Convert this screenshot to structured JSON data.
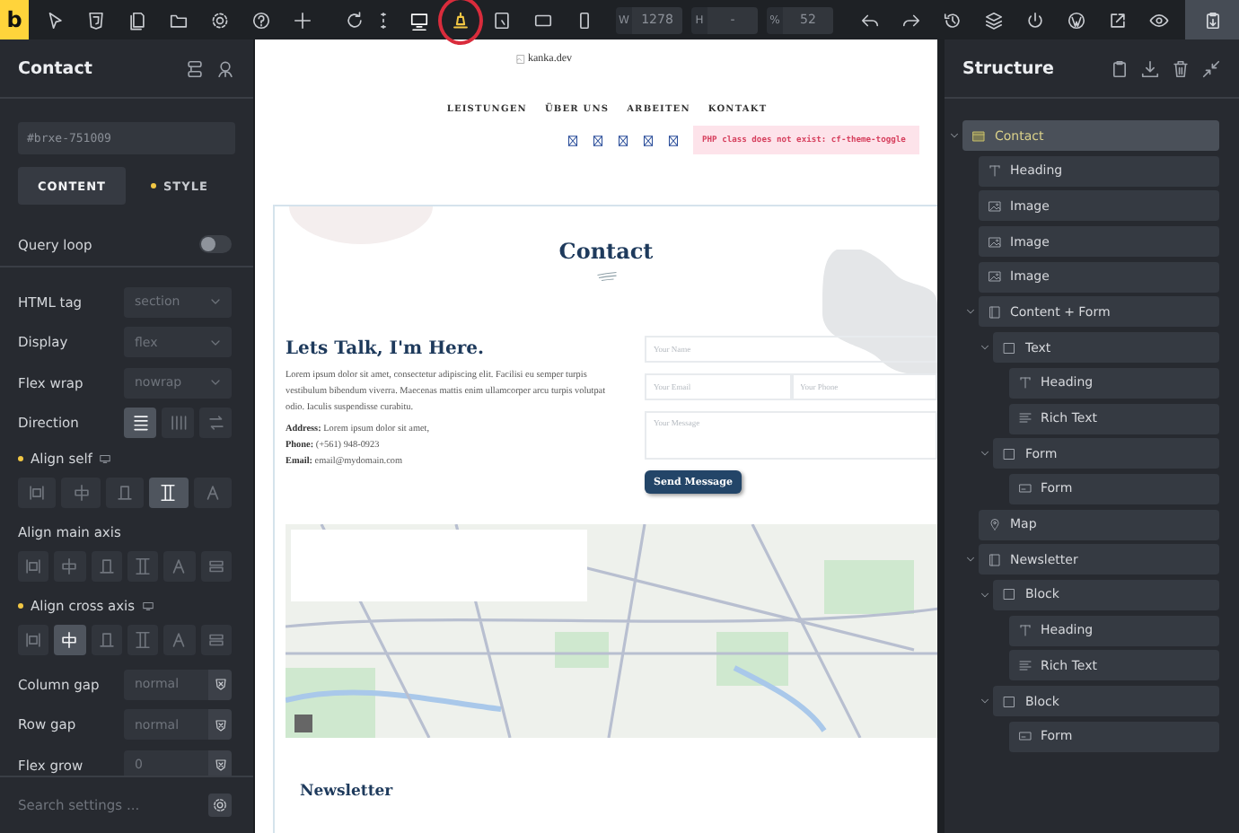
{
  "toolbar": {
    "logo": "b",
    "devices": [
      {
        "selected": true
      },
      {
        "selected": false
      },
      {
        "selected": false
      },
      {
        "selected": false
      }
    ],
    "highlight": {
      "on": true
    },
    "size_fields": [
      {
        "label": "W",
        "value": "1278"
      },
      {
        "label": "H",
        "value": "-"
      },
      {
        "label": "%",
        "value": "52"
      }
    ]
  },
  "left": {
    "title": "Contact",
    "element_id": "#brxe-751009",
    "tabs": [
      {
        "label": "CONTENT",
        "selected": true,
        "modified": false
      },
      {
        "label": "STYLE",
        "selected": false,
        "modified": true
      }
    ],
    "query_loop": {
      "label": "Query loop",
      "on": false
    },
    "settings": [
      {
        "kind": "select",
        "label": "HTML tag",
        "value": "section"
      },
      {
        "kind": "select",
        "label": "Display",
        "value": "flex"
      },
      {
        "kind": "select",
        "label": "Flex wrap",
        "value": "nowrap"
      },
      {
        "kind": "inline",
        "label": "Direction",
        "options": [
          {
            "selected": true
          },
          {
            "selected": false
          },
          {
            "selected": false
          }
        ]
      },
      {
        "kind": "block",
        "label": "Align self",
        "modified": true,
        "options": [
          {
            "selected": false
          },
          {
            "selected": false
          },
          {
            "selected": false
          },
          {
            "selected": true
          },
          {
            "selected": false
          }
        ]
      },
      {
        "kind": "block",
        "label": "Align main axis",
        "modified": false,
        "options": [
          {
            "selected": false
          },
          {
            "selected": false
          },
          {
            "selected": false
          },
          {
            "selected": false
          },
          {
            "selected": false
          },
          {
            "selected": false
          }
        ]
      },
      {
        "kind": "block",
        "label": "Align cross axis",
        "modified": true,
        "options": [
          {
            "selected": false
          },
          {
            "selected": true
          },
          {
            "selected": false
          },
          {
            "selected": false
          },
          {
            "selected": false
          },
          {
            "selected": false
          }
        ]
      },
      {
        "kind": "input",
        "label": "Column gap",
        "placeholder": "normal"
      },
      {
        "kind": "input",
        "label": "Row gap",
        "placeholder": "normal"
      },
      {
        "kind": "input",
        "label": "Flex grow",
        "placeholder": "0"
      }
    ],
    "search": {
      "placeholder": "Search settings ..."
    }
  },
  "canvas": {
    "logo_alt": "kanka.dev",
    "nav": [
      "LEISTUNGEN",
      "ÜBER UNS",
      "ARBEITEN",
      "KONTAKT"
    ],
    "error": "PHP class does not exist: cf-theme-toggle",
    "section": {
      "heading": "Contact",
      "subheading": "Lets Talk, I'm Here.",
      "text": "Lorem ipsum dolor sit amet, consectetur adipiscing elit. Facilisi eu semper turpis vestibulum bibendum viverra. Maecenas mattis enim ullamcorper arcu turpis volutpat odio. Iaculis suspendisse curabitu.",
      "details": [
        "**Address:** Lorem ipsum dolor sit amet,",
        "**Phone:** (+561) 948-0923",
        "**Email:** email@mydomain.com"
      ],
      "form": {
        "fields": [
          {
            "kind": "wide",
            "placeholder": "Your Name"
          },
          {
            "kind": "half",
            "placeholder": "Your Email"
          },
          {
            "kind": "half",
            "placeholder": "Your Phone"
          },
          {
            "kind": "message",
            "placeholder": "Your Message"
          }
        ],
        "button": "Send Message"
      }
    },
    "newsletter": {
      "heading": "Newsletter"
    }
  },
  "structure": {
    "title": "Structure",
    "tree": [
      {
        "label": "Contact",
        "kind": "section",
        "selected": true,
        "expanded": true,
        "children": [
          {
            "label": "Heading",
            "kind": "heading",
            "selected": false
          },
          {
            "label": "Image",
            "kind": "image",
            "selected": false
          },
          {
            "label": "Image",
            "kind": "image",
            "selected": false
          },
          {
            "label": "Image",
            "kind": "image",
            "selected": false
          },
          {
            "label": "Content + Form",
            "kind": "container",
            "selected": false,
            "expanded": true,
            "children": [
              {
                "label": "Text",
                "kind": "block",
                "selected": false,
                "expanded": true,
                "children": [
                  {
                    "label": "Heading",
                    "kind": "heading",
                    "selected": false
                  },
                  {
                    "label": "Rich Text",
                    "kind": "text",
                    "selected": false
                  }
                ]
              },
              {
                "label": "Form",
                "kind": "block",
                "selected": false,
                "expanded": true,
                "children": [
                  {
                    "label": "Form",
                    "kind": "form",
                    "selected": false
                  }
                ]
              }
            ]
          },
          {
            "label": "Map",
            "kind": "map",
            "selected": false
          },
          {
            "label": "Newsletter",
            "kind": "container",
            "selected": false,
            "expanded": true,
            "children": [
              {
                "label": "Block",
                "kind": "block",
                "selected": false,
                "expanded": true,
                "children": [
                  {
                    "label": "Heading",
                    "kind": "heading",
                    "selected": false
                  },
                  {
                    "label": "Rich Text",
                    "kind": "text",
                    "selected": false
                  }
                ]
              },
              {
                "label": "Block",
                "kind": "block",
                "selected": false,
                "expanded": true,
                "children": [
                  {
                    "label": "Form",
                    "kind": "form",
                    "selected": false
                  }
                ]
              }
            ]
          }
        ]
      }
    ]
  }
}
